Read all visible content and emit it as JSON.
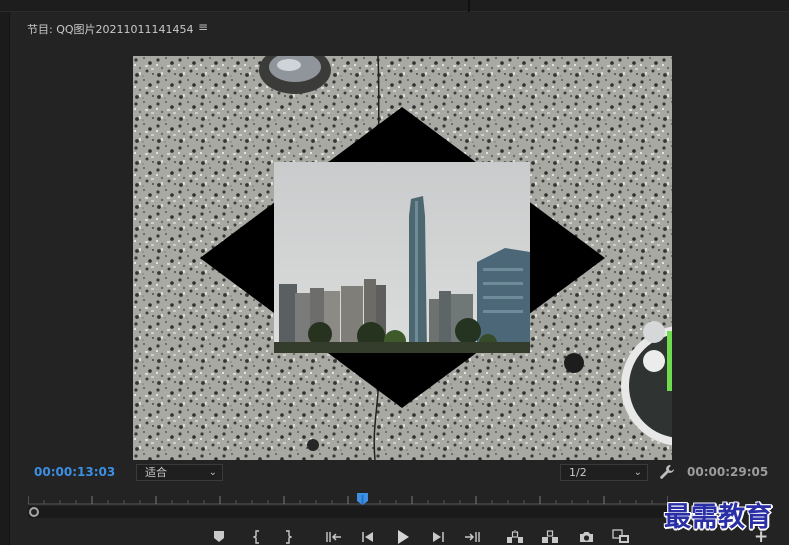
{
  "panel": {
    "title": "节目: QQ图片20211011141454",
    "menu_icon": "hamburger-menu-icon"
  },
  "monitor": {
    "current_timecode": "00:00:13:03",
    "duration_timecode": "00:00:29:05",
    "fit_select": {
      "value": "适合"
    },
    "resolution_select": {
      "value": "1/2"
    },
    "settings_icon": "wrench-icon",
    "playhead_position": 0.52
  },
  "controls": [
    {
      "name": "add-marker",
      "icon": "marker-icon"
    },
    {
      "name": "mark-in",
      "icon": "mark-in-icon"
    },
    {
      "name": "mark-out",
      "icon": "mark-out-icon"
    },
    {
      "name": "go-to-in",
      "icon": "go-to-in-icon"
    },
    {
      "name": "step-back",
      "icon": "step-back-icon"
    },
    {
      "name": "play",
      "icon": "play-icon"
    },
    {
      "name": "step-forward",
      "icon": "step-forward-icon"
    },
    {
      "name": "go-to-out",
      "icon": "go-to-out-icon"
    },
    {
      "name": "lift",
      "icon": "lift-icon"
    },
    {
      "name": "extract",
      "icon": "extract-icon"
    },
    {
      "name": "export-frame",
      "icon": "camera-icon"
    },
    {
      "name": "compare-view",
      "icon": "compare-icon"
    },
    {
      "name": "button-editor",
      "icon": "plus-icon"
    }
  ],
  "watermark": {
    "text": "最需教育"
  },
  "colors": {
    "accent": "#3d8fe3",
    "background": "#232323",
    "watermark": "#2a2fa6"
  }
}
